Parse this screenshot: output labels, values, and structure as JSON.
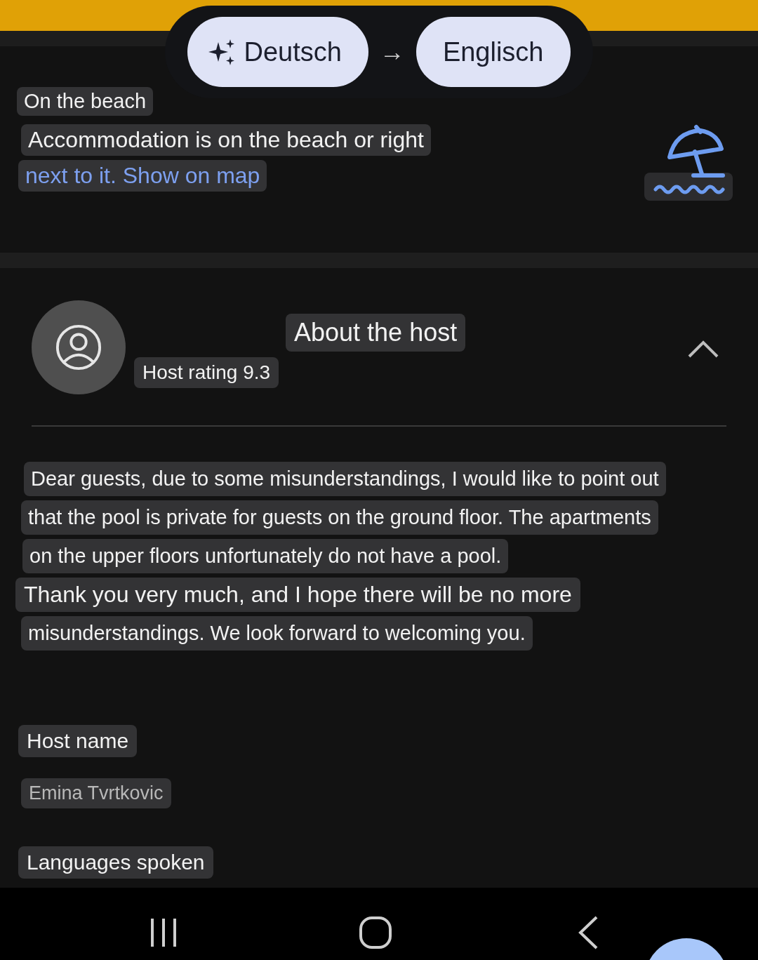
{
  "translate_bar": {
    "source_language": "Deutsch",
    "arrow": "→",
    "target_language": "Englisch"
  },
  "beach": {
    "title": "On the beach",
    "lines": [
      {
        "kind": "text",
        "text": "Accommodation is on the beach or right"
      },
      {
        "kind": "link",
        "text": "next to it. Show on map"
      }
    ]
  },
  "host": {
    "heading": "About the host",
    "rating": "Host rating 9.3",
    "expanded": true,
    "description_lines": [
      "Dear guests, due to some misunderstandings, I would like to point out",
      "that the pool is private for guests on the ground floor. The apartments",
      "on the upper floors unfortunately do not have a pool.",
      "Thank you very much, and I hope there will be no more",
      "misunderstandings. We look forward to welcoming you."
    ],
    "name_label": "Host name",
    "name": "Emina Tvrtkovic",
    "languages_label": "Languages spoken"
  }
}
